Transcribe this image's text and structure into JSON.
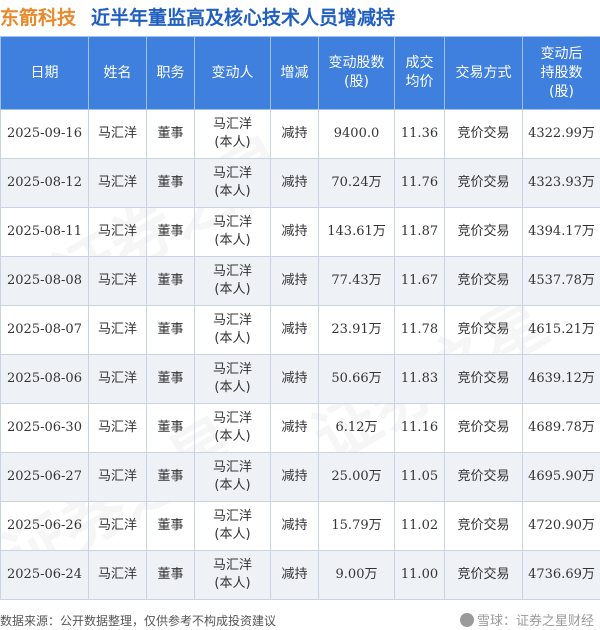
{
  "header": {
    "company": "东箭科技",
    "title": "近半年董监高及核心技术人员增减持"
  },
  "table": {
    "columns": [
      "日期",
      "姓名",
      "职务",
      "变动人",
      "增减",
      "变动股数\n(股)",
      "成交\n均价",
      "交易方式",
      "变动后\n持股数\n(股)"
    ],
    "rows": [
      {
        "date": "2025-09-16",
        "name": "马汇洋",
        "position": "董事",
        "changer_name": "马汇洋",
        "changer_rel": "(本人)",
        "direction": "减持",
        "shares": "9400.0",
        "price": "11.36",
        "method": "竞价交易",
        "after": "4322.99万"
      },
      {
        "date": "2025-08-12",
        "name": "马汇洋",
        "position": "董事",
        "changer_name": "马汇洋",
        "changer_rel": "(本人)",
        "direction": "减持",
        "shares": "70.24万",
        "price": "11.76",
        "method": "竞价交易",
        "after": "4323.93万"
      },
      {
        "date": "2025-08-11",
        "name": "马汇洋",
        "position": "董事",
        "changer_name": "马汇洋",
        "changer_rel": "(本人)",
        "direction": "减持",
        "shares": "143.61万",
        "price": "11.87",
        "method": "竞价交易",
        "after": "4394.17万"
      },
      {
        "date": "2025-08-08",
        "name": "马汇洋",
        "position": "董事",
        "changer_name": "马汇洋",
        "changer_rel": "(本人)",
        "direction": "减持",
        "shares": "77.43万",
        "price": "11.67",
        "method": "竞价交易",
        "after": "4537.78万"
      },
      {
        "date": "2025-08-07",
        "name": "马汇洋",
        "position": "董事",
        "changer_name": "马汇洋",
        "changer_rel": "(本人)",
        "direction": "减持",
        "shares": "23.91万",
        "price": "11.78",
        "method": "竞价交易",
        "after": "4615.21万"
      },
      {
        "date": "2025-08-06",
        "name": "马汇洋",
        "position": "董事",
        "changer_name": "马汇洋",
        "changer_rel": "(本人)",
        "direction": "减持",
        "shares": "50.66万",
        "price": "11.83",
        "method": "竞价交易",
        "after": "4639.12万"
      },
      {
        "date": "2025-06-30",
        "name": "马汇洋",
        "position": "董事",
        "changer_name": "马汇洋",
        "changer_rel": "(本人)",
        "direction": "减持",
        "shares": "6.12万",
        "price": "11.16",
        "method": "竞价交易",
        "after": "4689.78万"
      },
      {
        "date": "2025-06-27",
        "name": "马汇洋",
        "position": "董事",
        "changer_name": "马汇洋",
        "changer_rel": "(本人)",
        "direction": "减持",
        "shares": "25.00万",
        "price": "11.05",
        "method": "竞价交易",
        "after": "4695.90万"
      },
      {
        "date": "2025-06-26",
        "name": "马汇洋",
        "position": "董事",
        "changer_name": "马汇洋",
        "changer_rel": "(本人)",
        "direction": "减持",
        "shares": "15.79万",
        "price": "11.02",
        "method": "竞价交易",
        "after": "4720.90万"
      },
      {
        "date": "2025-06-24",
        "name": "马汇洋",
        "position": "董事",
        "changer_name": "马汇洋",
        "changer_rel": "(本人)",
        "direction": "减持",
        "shares": "9.00万",
        "price": "11.00",
        "method": "竞价交易",
        "after": "4736.69万"
      }
    ]
  },
  "footer": {
    "source": "数据来源：公开数据整理，仅供参考不构成投资建议",
    "brand": "雪球：证券之星财经"
  },
  "watermark": "证券之星",
  "colors": {
    "company": "#e8892b",
    "title": "#1f5fbf",
    "header_bg": "#3f7fde",
    "decrease": "#1a9c3a",
    "row_alt": "#eef1f6"
  }
}
